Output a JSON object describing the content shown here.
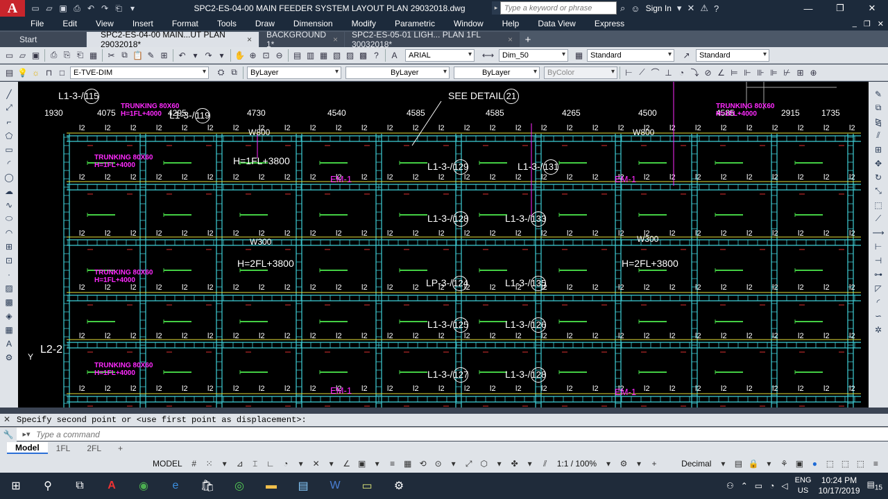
{
  "window": {
    "title": "SPC2-ES-04-00 MAIN FEEDER SYSTEM LAYOUT PLAN 29032018.dwg",
    "search_placeholder": "Type a keyword or phrase",
    "sign_in": "Sign In"
  },
  "menu": [
    "File",
    "Edit",
    "View",
    "Insert",
    "Format",
    "Tools",
    "Draw",
    "Dimension",
    "Modify",
    "Parametric",
    "Window",
    "Help",
    "Data View",
    "Express"
  ],
  "tabs": [
    {
      "label": "Start",
      "close": ""
    },
    {
      "label": "SPC2-ES-04-00 MAIN...UT PLAN 29032018*",
      "close": "×"
    },
    {
      "label": "BACKGROUND 1*",
      "close": "×"
    },
    {
      "label": "SPC2-ES-05-01 LIGH... PLAN 1FL 30032018*",
      "close": "×"
    }
  ],
  "tab_add": "+",
  "toolbar1": {
    "font": "ARIAL",
    "dimstyle": "Dim_50",
    "textstyle1": "Standard",
    "textstyle2": "Standard"
  },
  "toolbar2": {
    "layer": "E-TVE-DIM",
    "color": "ByLayer",
    "linetype": "ByLayer",
    "lineweight": "ByLayer",
    "plotstyle": "ByColor"
  },
  "drawing": {
    "circuits": [
      {
        "prefix": "L1-3-/",
        "num": "115"
      },
      {
        "prefix": "L1-3-/",
        "num": "119"
      },
      {
        "prefix": "SEE DETAIL",
        "num": "21"
      },
      {
        "prefix": "L1-3-/",
        "num": "129"
      },
      {
        "prefix": "L1-3-/",
        "num": "131"
      },
      {
        "prefix": "L1-3-/",
        "num": "128"
      },
      {
        "prefix": "L1-3-/",
        "num": "133"
      },
      {
        "prefix": "LP-3-/",
        "num": "124"
      },
      {
        "prefix": "L1-3-/",
        "num": "135"
      },
      {
        "prefix": "L1-3-/",
        "num": "125"
      },
      {
        "prefix": "L1-3-/",
        "num": "126"
      },
      {
        "prefix": "L1-3-/",
        "num": "127"
      },
      {
        "prefix": "L1-3-/",
        "num": "128"
      }
    ],
    "dims": [
      "1930",
      "4075",
      "4295",
      "4730",
      "4540",
      "4585",
      "4585",
      "4265",
      "4500",
      "4585",
      "2915",
      "1735"
    ],
    "trunking": "TRUNKING 80X60",
    "trunking_h": "H=1FL+4000",
    "h1": "H=1FL+3800",
    "h2": "H=2FL+3800",
    "w800": "W800",
    "w300": "W300",
    "em": "EM-1",
    "l2": "L2-2",
    "l2_tag": "l2",
    "axis_y": "Y"
  },
  "command": {
    "history": "Specify second point or <use first point as displacement>:",
    "placeholder": "Type a command"
  },
  "layouts": [
    "Model",
    "1FL",
    "2FL"
  ],
  "status": {
    "model": "MODEL",
    "scale": "1:1 / 100%",
    "units": "Decimal"
  },
  "tray": {
    "lang1": "ENG",
    "lang2": "US",
    "time": "10:24 PM",
    "date": "10/17/2019",
    "notif": "15"
  }
}
